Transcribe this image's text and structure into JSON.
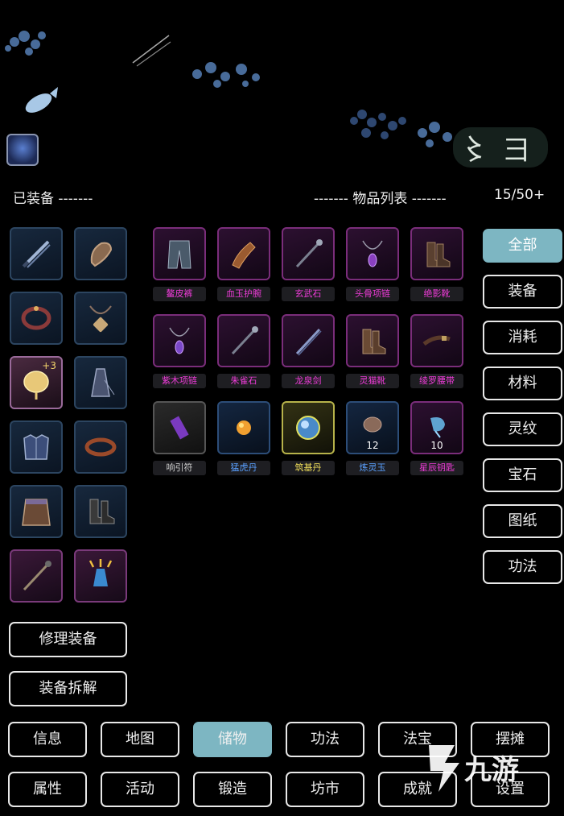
{
  "header": {
    "equipped_label": "已装备 -------",
    "items_label": "------- 物品列表 -------",
    "capacity": "15/50+"
  },
  "equipped_slots": [
    {
      "icon": "sword-icon",
      "badge": ""
    },
    {
      "icon": "bracer-icon",
      "badge": ""
    },
    {
      "icon": "ring-icon",
      "badge": ""
    },
    {
      "icon": "amulet-icon",
      "badge": ""
    },
    {
      "icon": "fan-icon",
      "badge": "+3"
    },
    {
      "icon": "robe-icon",
      "badge": ""
    },
    {
      "icon": "armor-icon",
      "badge": ""
    },
    {
      "icon": "belt-icon",
      "badge": ""
    },
    {
      "icon": "skirt-icon",
      "badge": ""
    },
    {
      "icon": "boots-icon",
      "badge": ""
    },
    {
      "icon": "staff-icon",
      "badge": ""
    },
    {
      "icon": "vase-icon",
      "badge": ""
    }
  ],
  "items": [
    {
      "name": "鳌皮裤",
      "rarity": "pink",
      "icon": "pants-icon",
      "qty": ""
    },
    {
      "name": "血玉护腕",
      "rarity": "pink",
      "icon": "bracer-icon",
      "qty": ""
    },
    {
      "name": "玄武石",
      "rarity": "pink",
      "icon": "staff-icon",
      "qty": ""
    },
    {
      "name": "头骨项链",
      "rarity": "pink",
      "icon": "necklace-icon",
      "qty": ""
    },
    {
      "name": "绝影靴",
      "rarity": "pink",
      "icon": "boots-icon",
      "qty": ""
    },
    {
      "name": "紫木项链",
      "rarity": "pink",
      "icon": "necklace-icon",
      "qty": ""
    },
    {
      "name": "朱雀石",
      "rarity": "pink",
      "icon": "staff-icon",
      "qty": ""
    },
    {
      "name": "龙泉剑",
      "rarity": "pink",
      "icon": "sword-icon",
      "qty": ""
    },
    {
      "name": "灵猫靴",
      "rarity": "pink",
      "icon": "boots-icon",
      "qty": ""
    },
    {
      "name": "绫罗腰带",
      "rarity": "pink",
      "icon": "belt-icon",
      "qty": ""
    },
    {
      "name": "响引符",
      "rarity": "grey",
      "icon": "talisman-icon",
      "qty": ""
    },
    {
      "name": "猛虎丹",
      "rarity": "blue",
      "icon": "pill-icon",
      "qty": ""
    },
    {
      "name": "筑基丹",
      "rarity": "yellow",
      "icon": "orb-icon",
      "qty": ""
    },
    {
      "name": "炼灵玉",
      "rarity": "blue",
      "icon": "stone-icon",
      "qty": "12"
    },
    {
      "name": "星辰钥匙",
      "rarity": "pink",
      "icon": "key-icon",
      "qty": "10"
    }
  ],
  "tabs": [
    "全部",
    "装备",
    "消耗",
    "材料",
    "灵纹",
    "宝石",
    "图纸",
    "功法"
  ],
  "active_tab": "全部",
  "actions": {
    "repair": "修理装备",
    "dismantle": "装备拆解"
  },
  "nav_row1": [
    "信息",
    "地图",
    "储物",
    "功法",
    "法宝",
    "摆摊"
  ],
  "nav_row2": [
    "属性",
    "活动",
    "锻造",
    "坊市",
    "成就",
    "设置"
  ],
  "active_nav": "储物",
  "watermark": "九游",
  "colors": {
    "accent": "#7db6c2",
    "pink": "#ee3cd8",
    "blue": "#5aa0ff",
    "yellow": "#f1df5a"
  }
}
